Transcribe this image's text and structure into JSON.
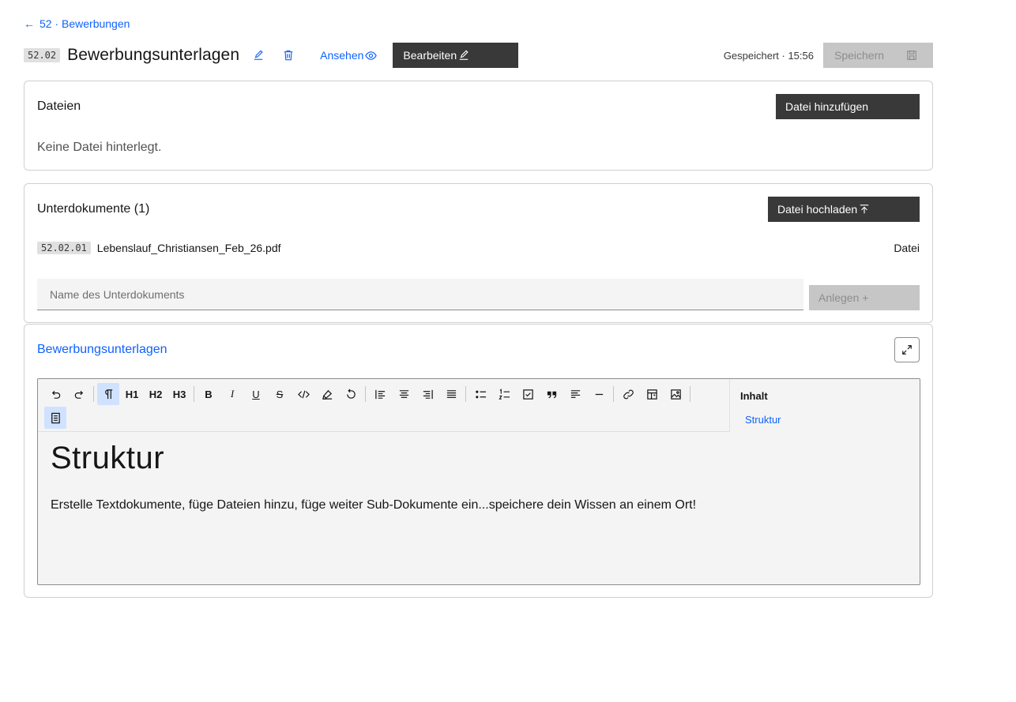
{
  "breadcrumb": {
    "arrow": "←",
    "label": "52 · Bewerbungen"
  },
  "header": {
    "id": "52.02",
    "title": "Bewerbungsunterlagen",
    "view_label": "Ansehen",
    "edit_label": "Bearbeiten",
    "saved_status": "Gespeichert · 15:56",
    "save_label": "Speichern"
  },
  "files": {
    "title": "Dateien",
    "add_label": "Datei hinzufügen",
    "empty_text": "Keine Datei hinterlegt."
  },
  "subdocs": {
    "title": "Unterdokumente (1)",
    "upload_label": "Datei hochladen",
    "items": [
      {
        "id": "52.02.01",
        "name": "Lebenslauf_Christiansen_Feb_26.pdf",
        "type": "Datei"
      }
    ],
    "input_placeholder": "Name des Unterdokuments",
    "create_label": "Anlegen +"
  },
  "editor": {
    "title": "Bewerbungsunterlagen",
    "toolbar": {
      "h1": "H1",
      "h2": "H2",
      "h3": "H3",
      "bold": "B",
      "italic": "I",
      "underline": "U",
      "strike": "S"
    },
    "outline": {
      "title": "Inhalt",
      "items": [
        "Struktur"
      ]
    },
    "content": {
      "heading": "Struktur",
      "paragraph": "Erstelle Textdokumente, füge Dateien hinzu, füge weiter Sub-Dokumente ein...speichere dein Wissen an einem Ort!"
    }
  },
  "colors": {
    "accent": "#0f62fe",
    "dark_button": "#393939",
    "disabled": "#c6c6c6",
    "active_tool": "#d0e2ff"
  }
}
